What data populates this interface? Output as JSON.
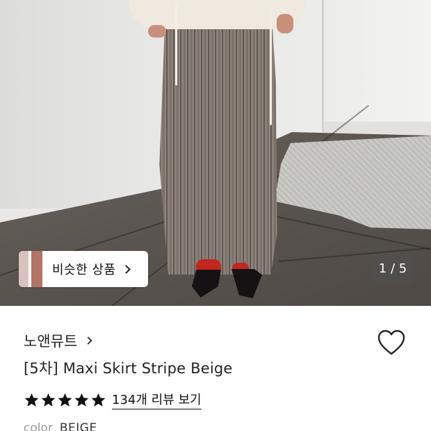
{
  "gallery": {
    "similar_products_label": "비슷한 상품",
    "image_counter": "1 / 5"
  },
  "product": {
    "brand": "노앤뮤트",
    "title": "[5차] Maxi Skirt Stripe Beige",
    "rating_stars": 5,
    "review_link": "134개 리뷰 보기",
    "color_label": "color",
    "color_value": "BEIGE"
  },
  "icons": {
    "wishlist": "heart-outline-icon",
    "star": "star-filled-icon",
    "chevron": "chevron-right-icon"
  },
  "colors": {
    "text": "#111111",
    "star": "#111111",
    "muted": "#999999"
  }
}
